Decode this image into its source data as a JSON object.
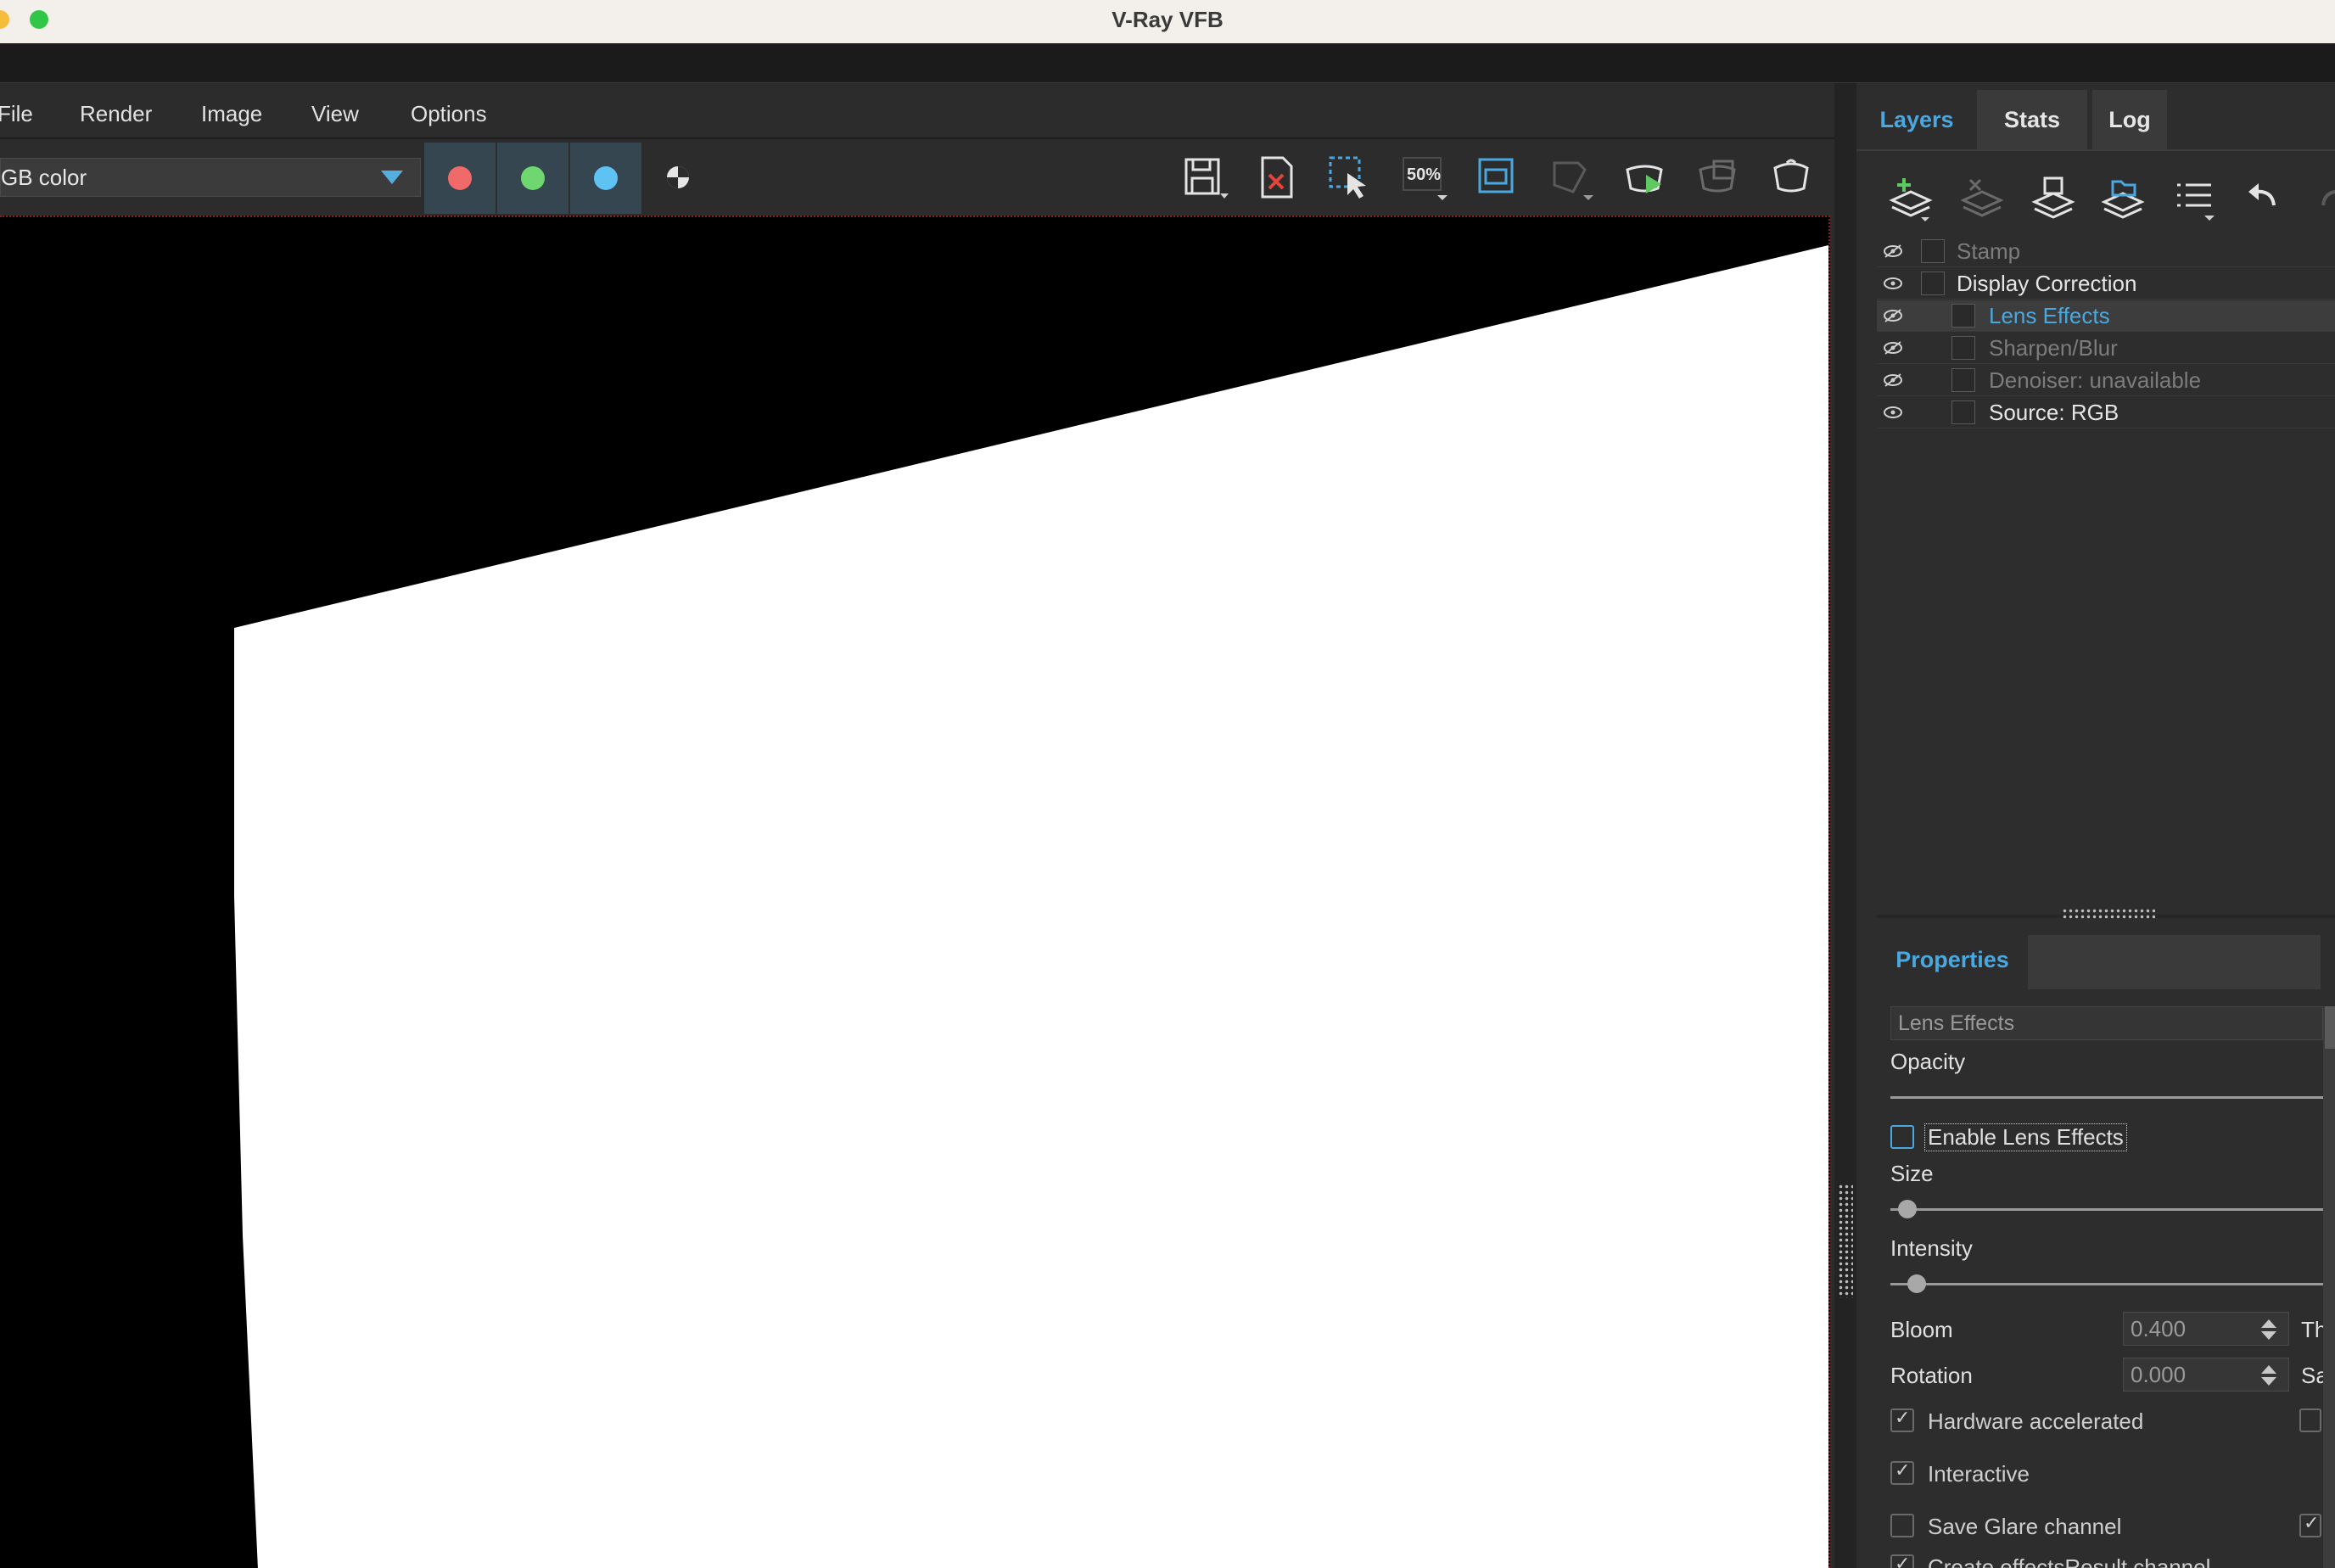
{
  "window": {
    "title": "V-Ray VFB",
    "traffic_colors": {
      "minimize": "#f6bd3b",
      "zoom": "#32c648"
    }
  },
  "menubar": [
    "File",
    "Render",
    "Image",
    "View",
    "Options"
  ],
  "toolbar": {
    "channel_value": "GB color",
    "channel_buttons": [
      {
        "name": "red-channel",
        "color": "#f06a6a"
      },
      {
        "name": "green-channel",
        "color": "#6fd76f"
      },
      {
        "name": "blue-channel",
        "color": "#5ec2f2"
      }
    ],
    "zoom_label": "50%",
    "icons": [
      "save-icon",
      "clear-image-icon",
      "region-select-icon",
      "zoom-50-icon",
      "fit-frame-icon",
      "track-mouse-icon",
      "render-icon",
      "render-interactive-icon",
      "render-teapot-icon"
    ]
  },
  "right_panel": {
    "tabs": [
      "Layers",
      "Stats",
      "Log"
    ],
    "active_tab": "Layers",
    "layer_tools": [
      "add-layer-icon",
      "delete-layer-icon",
      "save-layers-icon",
      "load-layers-icon",
      "layer-list-icon",
      "undo-icon",
      "redo-icon"
    ],
    "layers": [
      {
        "label": "Stamp",
        "visible": false,
        "indent": false,
        "state": "dim"
      },
      {
        "label": "Display Correction",
        "visible": true,
        "indent": false,
        "state": "bright"
      },
      {
        "label": "Lens Effects",
        "visible": false,
        "indent": true,
        "state": "selected"
      },
      {
        "label": "Sharpen/Blur",
        "visible": false,
        "indent": true,
        "state": "dim"
      },
      {
        "label": "Denoiser: unavailable",
        "visible": false,
        "indent": true,
        "state": "dim"
      },
      {
        "label": "Source: RGB",
        "visible": true,
        "indent": true,
        "state": "bright"
      }
    ]
  },
  "properties": {
    "tab": "Properties",
    "layer_name": "Lens Effects",
    "opacity_label": "Opacity",
    "enable_label": "Enable Lens Effects",
    "enable_checked": false,
    "size_label": "Size",
    "size_value": 0.04,
    "intensity_label": "Intensity",
    "intensity_value": 0.06,
    "bloom_label": "Bloom",
    "bloom_value": "0.400",
    "bloom_right_label": "Th",
    "rotation_label": "Rotation",
    "rotation_value": "0.000",
    "rotation_right_label": "Sa",
    "hardware_label": "Hardware accelerated",
    "hardware_checked": true,
    "interactive_label": "Interactive",
    "interactive_checked": true,
    "save_glare_label": "Save Glare channel",
    "save_glare_checked": false,
    "create_effects_label": "Create effectsResult channel",
    "create_effects_checked": true
  }
}
